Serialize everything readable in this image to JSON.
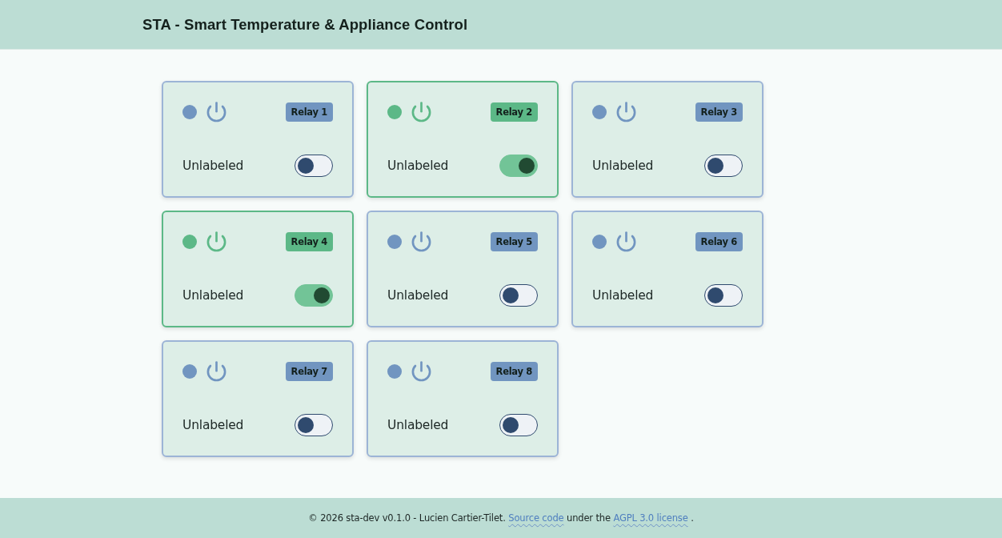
{
  "header": {
    "title": "STA - Smart Temperature & Appliance Control"
  },
  "relays": [
    {
      "badge": "Relay 1",
      "label": "Unlabeled",
      "on": false
    },
    {
      "badge": "Relay 2",
      "label": "Unlabeled",
      "on": true
    },
    {
      "badge": "Relay 3",
      "label": "Unlabeled",
      "on": false
    },
    {
      "badge": "Relay 4",
      "label": "Unlabeled",
      "on": true
    },
    {
      "badge": "Relay 5",
      "label": "Unlabeled",
      "on": false
    },
    {
      "badge": "Relay 6",
      "label": "Unlabeled",
      "on": false
    },
    {
      "badge": "Relay 7",
      "label": "Unlabeled",
      "on": false
    },
    {
      "badge": "Relay 8",
      "label": "Unlabeled",
      "on": false
    }
  ],
  "footer": {
    "text_before": "© 2026 sta-dev v0.1.0 - Lucien Cartier-Tilet.",
    "source_link": "Source code",
    "text_middle": "under the",
    "license_link": "AGPL 3.0 license",
    "text_after": "."
  }
}
